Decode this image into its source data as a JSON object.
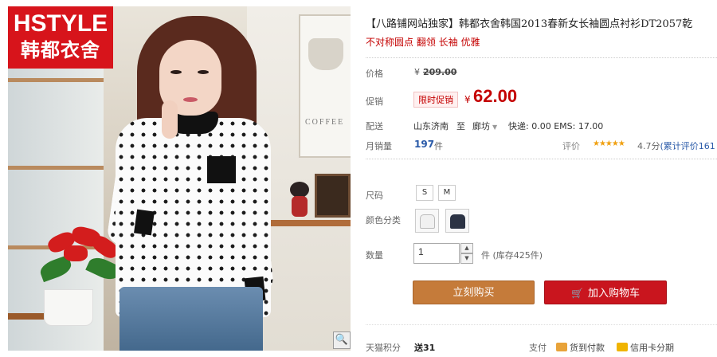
{
  "brand": {
    "logo_en": "HSTYLE",
    "logo_cn": "韩都衣舍"
  },
  "gallery": {
    "poster_text": "COFFEE",
    "zoom_icon": "magnifier-icon"
  },
  "product": {
    "title": "【八路铺网站独家】韩都衣舍韩国2013春新女长袖圆点衬衫DT2057乾",
    "subtitle": "不对称圆点 翻领 长袖 优雅"
  },
  "price": {
    "label": "价格",
    "currency": "¥",
    "original": "209.00",
    "promo_label": "促销",
    "promo_tag": "限时促销",
    "promo_currency": "¥",
    "promo_price": "62.00"
  },
  "shipping": {
    "label": "配送",
    "from": "山东济南",
    "to_word": "至",
    "to": "廊坊",
    "fee": "快递: 0.00 EMS: 17.00"
  },
  "sales": {
    "label": "月销量",
    "count": "197",
    "unit": "件",
    "rating_label": "评价",
    "stars": "★★★★★",
    "score": "4.7分",
    "reviews": "(累计评价161"
  },
  "size": {
    "label": "尺码",
    "options": [
      "S",
      "M"
    ]
  },
  "color": {
    "label": "颜色分类",
    "swatches": [
      "white",
      "navy"
    ]
  },
  "quantity": {
    "label": "数量",
    "value": "1",
    "unit": "件",
    "stock": "(库存425件)"
  },
  "actions": {
    "buy_now": "立刻购买",
    "add_to_cart": "加入购物车"
  },
  "footer": {
    "points_label": "天猫积分",
    "points_value": "送31",
    "pay_label": "支付",
    "cod": "货到付款",
    "credit": "信用卡分期"
  },
  "colors": {
    "accent_red": "#c40000",
    "brand_red": "#d7141b",
    "buy_orange": "#c57b3a",
    "cart_red": "#c9151e"
  }
}
